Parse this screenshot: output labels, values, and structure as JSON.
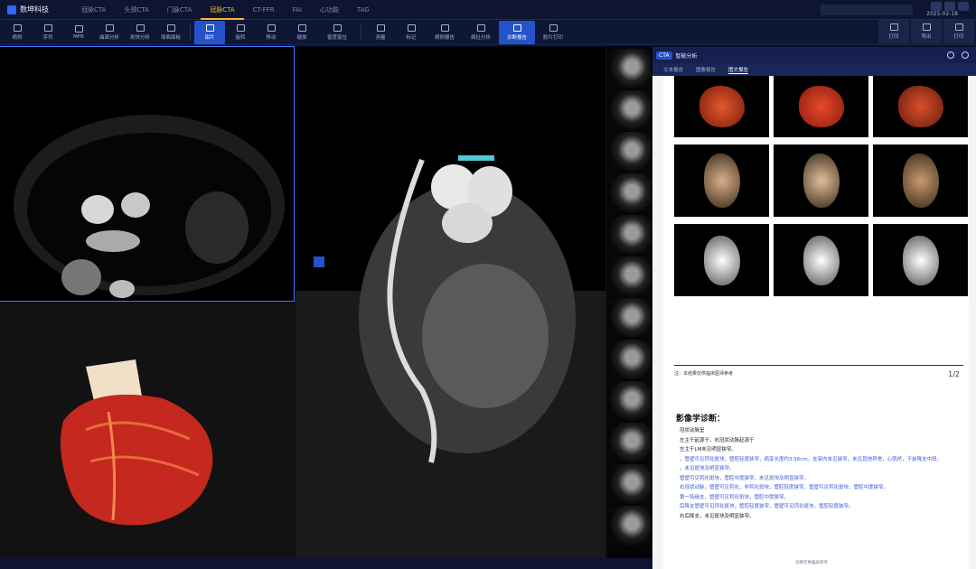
{
  "app": {
    "logo_text": "数坤科技",
    "date": "2025-02-18",
    "tabs": [
      {
        "label": "冠脉CTA",
        "active": false
      },
      {
        "label": "头颈CTA",
        "active": false
      },
      {
        "label": "门脉CTA",
        "active": false
      },
      {
        "label": "冠脉CTA",
        "active": true
      },
      {
        "label": "CT-FFR",
        "active": false
      },
      {
        "label": "FAI",
        "active": false
      },
      {
        "label": "心功能",
        "active": false
      },
      {
        "label": "TAG",
        "active": false
      }
    ]
  },
  "toolbar": {
    "tools": [
      "病例",
      "序列",
      "MPR",
      "曲面分析",
      "斑块分析",
      "球面面板",
      "钳片",
      "旋转",
      "移动",
      "缩放",
      "窗宽窗位",
      "测量",
      "标记",
      "病例报告",
      "病灶分析",
      "诊断报告",
      "胶片打印"
    ],
    "active_tool": "诊断报告",
    "right_tools": [
      "打印",
      "导出",
      "打印"
    ]
  },
  "report": {
    "badge": "CTA",
    "title": "智能分析",
    "tabs": [
      {
        "label": "文本报告",
        "active": false
      },
      {
        "label": "图像报告",
        "active": false
      },
      {
        "label": "图文报告",
        "active": true
      }
    ],
    "note": "注：本结果仅供临床医师参考",
    "page_indicator": "1/2",
    "diagnosis_title": "影像学诊断：",
    "diagnosis_lines": [
      "冠状动脉呈",
      "左主干起源于，右冠状动脉起源于",
      "左主干LM未见明显狭窄。",
      "，管壁可见钙化斑块，管腔轻度狭窄，病变长度约3.56cm，支架内未见狭窄，未见其他异常，心肌桥，于前降支中段，",
      "，未见斑块及明显狭窄。",
      "管壁可见钙化斑块，管腔中度狭窄，未见斑块及明显狭窄。",
      "右冠状动脉，管壁可见钙化，非钙化斑块，管腔轻度狭窄，管壁可见钙化斑块，管腔中度狭窄。",
      "第一钝缘支，管壁可见钙化斑块，管腔中度狭窄。",
      "后降支管壁可见钙化斑块，管腔轻度狭窄，管壁可见钙化斑块，管腔轻度狭窄。",
      "右后降支，未见斑块及明显狭窄。"
    ],
    "footer": "诊断仅供临床参考"
  },
  "colors": {
    "accent": "#2452c8",
    "active_tab": "#f2b635",
    "background": "#0a0f1c"
  }
}
